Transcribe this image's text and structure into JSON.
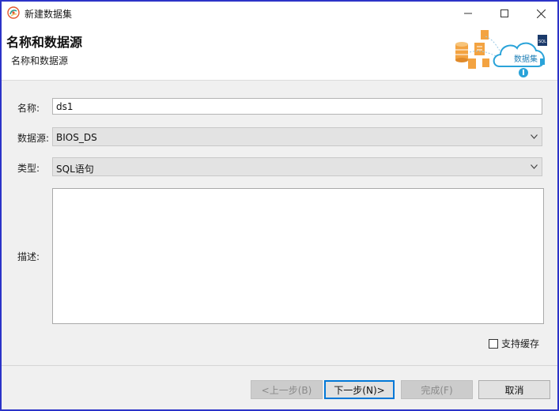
{
  "window": {
    "title": "新建数据集",
    "icons": {
      "app": "app-logo-icon",
      "minimize": "minimize-icon",
      "maximize": "maximize-icon",
      "close": "close-icon"
    }
  },
  "header": {
    "title": "名称和数据源",
    "subtitle": "名称和数据源",
    "banner": {
      "cloud_label": "数据集",
      "badge_label": "SQL"
    }
  },
  "form": {
    "name": {
      "label": "名称:",
      "value": "ds1"
    },
    "datasource": {
      "label": "数据源:",
      "value": "BIOS_DS"
    },
    "type": {
      "label": "类型:",
      "value": "SQL语句"
    },
    "description": {
      "label": "描述:",
      "value": ""
    },
    "cache": {
      "label": "支持缓存",
      "checked": false
    }
  },
  "footer": {
    "prev_label": "<上一步(B)",
    "next_label": "下一步(N)>",
    "finish_label": "完成(F)",
    "cancel_label": "取消"
  },
  "colors": {
    "window_border": "#2b33c8",
    "accent": "#0078d7",
    "cloud": "#2aa3d9",
    "files": "#f3a341"
  }
}
